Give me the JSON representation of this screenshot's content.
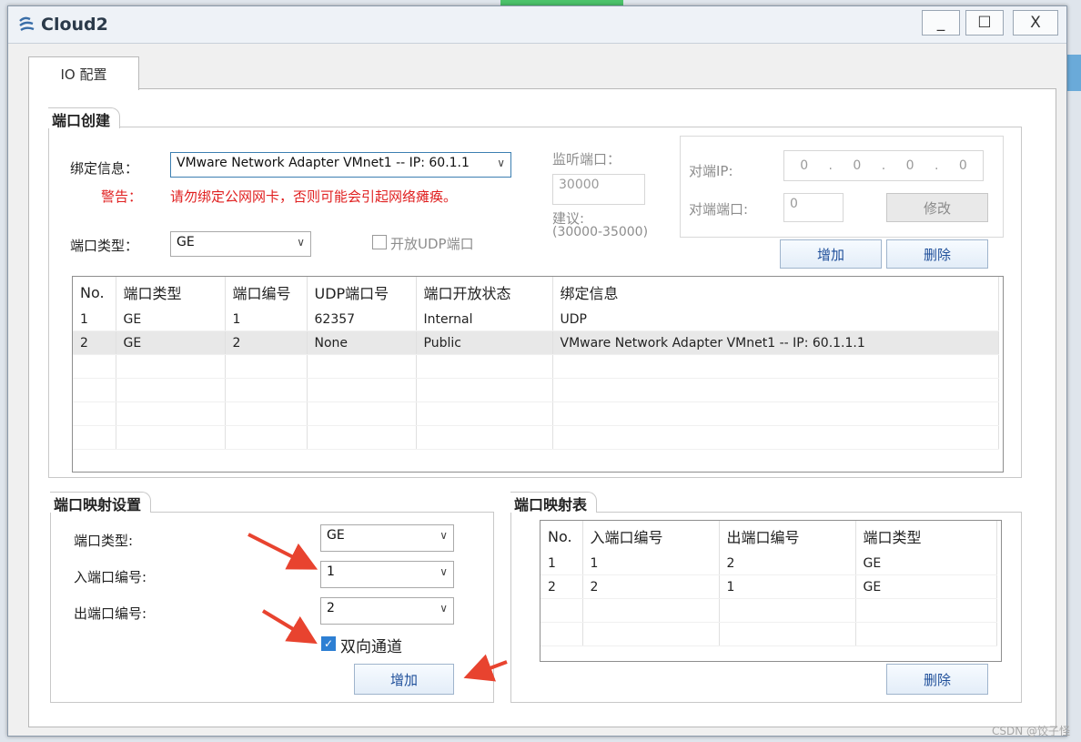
{
  "window": {
    "title": "Cloud2",
    "minimize": "_",
    "maximize": "☐",
    "close": "X"
  },
  "tab": {
    "label": "IO 配置"
  },
  "port_create": {
    "legend": "端口创建",
    "bind_label": "绑定信息：",
    "bind_value": "VMware Network Adapter VMnet1 -- IP: 60.1.1",
    "warn_label": "警告：",
    "warn_text": "请勿绑定公网网卡，否则可能会引起网络瘫痪。",
    "port_type_label": "端口类型：",
    "port_type_value": "GE",
    "udp_open_label": "开放UDP端口",
    "udp_open_checked": false,
    "listen_label": "监听端口：",
    "listen_value": "30000",
    "suggest_label": "建议:",
    "suggest_range": "(30000-35000)",
    "peer_ip_label": "对端IP:",
    "peer_ip": [
      "0",
      "0",
      "0",
      "0"
    ],
    "peer_port_label": "对端端口:",
    "peer_port_value": "0",
    "modify_button": "修改",
    "add_button": "增加",
    "delete_button": "删除",
    "table": {
      "headers": [
        "No.",
        "端口类型",
        "端口编号",
        "UDP端口号",
        "端口开放状态",
        "绑定信息"
      ],
      "rows": [
        [
          "1",
          "GE",
          "1",
          "62357",
          "Internal",
          "UDP"
        ],
        [
          "2",
          "GE",
          "2",
          "None",
          "Public",
          "VMware Network Adapter VMnet1 -- IP: 60.1.1.1"
        ]
      ],
      "selected_row": 1
    }
  },
  "mapping_settings": {
    "legend": "端口映射设置",
    "port_type_label": "端口类型:",
    "port_type_value": "GE",
    "in_port_label": "入端口编号:",
    "in_port_value": "1",
    "out_port_label": "出端口编号:",
    "out_port_value": "2",
    "bidirectional_label": "双向通道",
    "bidirectional_checked": true,
    "add_button": "增加"
  },
  "mapping_table": {
    "legend": "端口映射表",
    "headers": [
      "No.",
      "入端口编号",
      "出端口编号",
      "端口类型"
    ],
    "rows": [
      [
        "1",
        "1",
        "2",
        "GE"
      ],
      [
        "2",
        "2",
        "1",
        "GE"
      ]
    ],
    "delete_button": "删除"
  },
  "watermark": "CSDN @饺子怪",
  "colors": {
    "warning": "#e02020",
    "arrow": "#e8432f",
    "accent": "#2d7fd3"
  }
}
